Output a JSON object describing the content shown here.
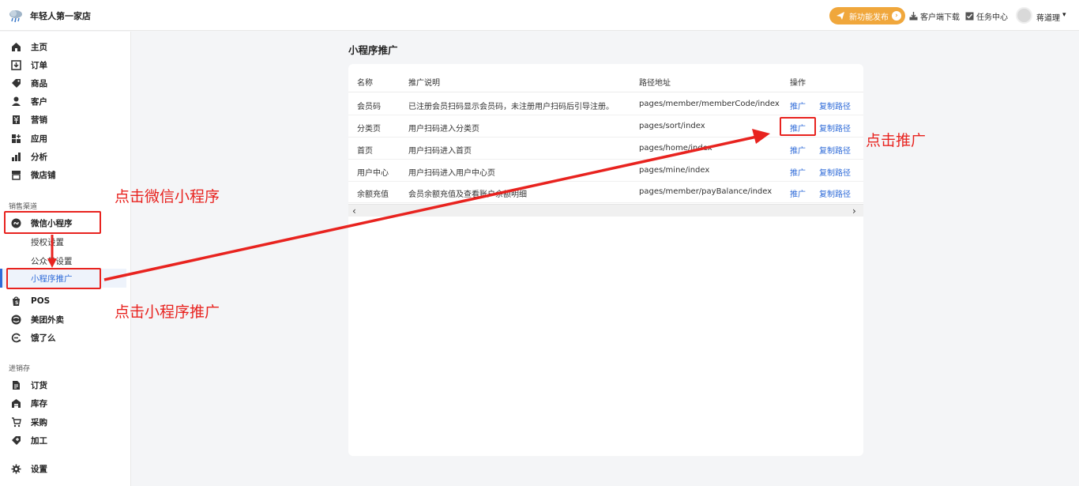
{
  "header": {
    "store_name": "年轻人第一家店",
    "release_label": "新功能发布",
    "download_label": "客户端下载",
    "task_label": "任务中心",
    "username": "蒋道理"
  },
  "sidebar": {
    "items": [
      {
        "label": "主页",
        "icon": "home-icon"
      },
      {
        "label": "订单",
        "icon": "order-icon"
      },
      {
        "label": "商品",
        "icon": "tag-icon"
      },
      {
        "label": "客户",
        "icon": "user-icon"
      },
      {
        "label": "营销",
        "icon": "marketing-icon"
      },
      {
        "label": "应用",
        "icon": "apps-icon"
      },
      {
        "label": "分析",
        "icon": "chart-icon"
      },
      {
        "label": "微店铺",
        "icon": "store-icon"
      }
    ],
    "section_sales": "销售渠道",
    "sales_items": [
      {
        "label": "微信小程序",
        "icon": "miniprogram-icon"
      }
    ],
    "sub_items": [
      "授权设置",
      "公众号设置",
      "小程序推广"
    ],
    "more_items": [
      {
        "label": "POS",
        "icon": "pos-icon"
      },
      {
        "label": "美团外卖",
        "icon": "meituan-icon"
      },
      {
        "label": "饿了么",
        "icon": "eleme-icon"
      }
    ],
    "section_inventory": "进销存",
    "inventory_items": [
      {
        "label": "订货",
        "icon": "document-icon"
      },
      {
        "label": "库存",
        "icon": "warehouse-icon"
      },
      {
        "label": "采购",
        "icon": "cart-icon"
      },
      {
        "label": "加工",
        "icon": "process-icon"
      }
    ],
    "settings_label": "设置"
  },
  "main": {
    "title": "小程序推广",
    "columns": [
      "名称",
      "推广说明",
      "路径地址",
      "操作"
    ],
    "rows": [
      {
        "name": "会员码",
        "desc": "已注册会员扫码显示会员码，未注册用户扫码后引导注册。",
        "path": "pages/member/memberCode/index",
        "action1": "推广",
        "action2": "复制路径"
      },
      {
        "name": "分类页",
        "desc": "用户扫码进入分类页",
        "path": "pages/sort/index",
        "action1": "推广",
        "action2": "复制路径"
      },
      {
        "name": "首页",
        "desc": "用户扫码进入首页",
        "path": "pages/home/index",
        "action1": "推广",
        "action2": "复制路径"
      },
      {
        "name": "用户中心",
        "desc": "用户扫码进入用户中心页",
        "path": "pages/mine/index",
        "action1": "推广",
        "action2": "复制路径"
      },
      {
        "name": "余额充值",
        "desc": "会员余额充值及查看账户余额明细",
        "path": "pages/member/payBalance/index",
        "action1": "推广",
        "action2": "复制路径"
      }
    ]
  },
  "annotations": {
    "click_miniprogram": "点击微信小程序",
    "click_promo": "点击小程序推广",
    "click_tuiguang": "点击推广"
  },
  "colors": {
    "accent": "#2f6bd8",
    "annotation": "#e8231f",
    "release": "#f0a73c"
  }
}
